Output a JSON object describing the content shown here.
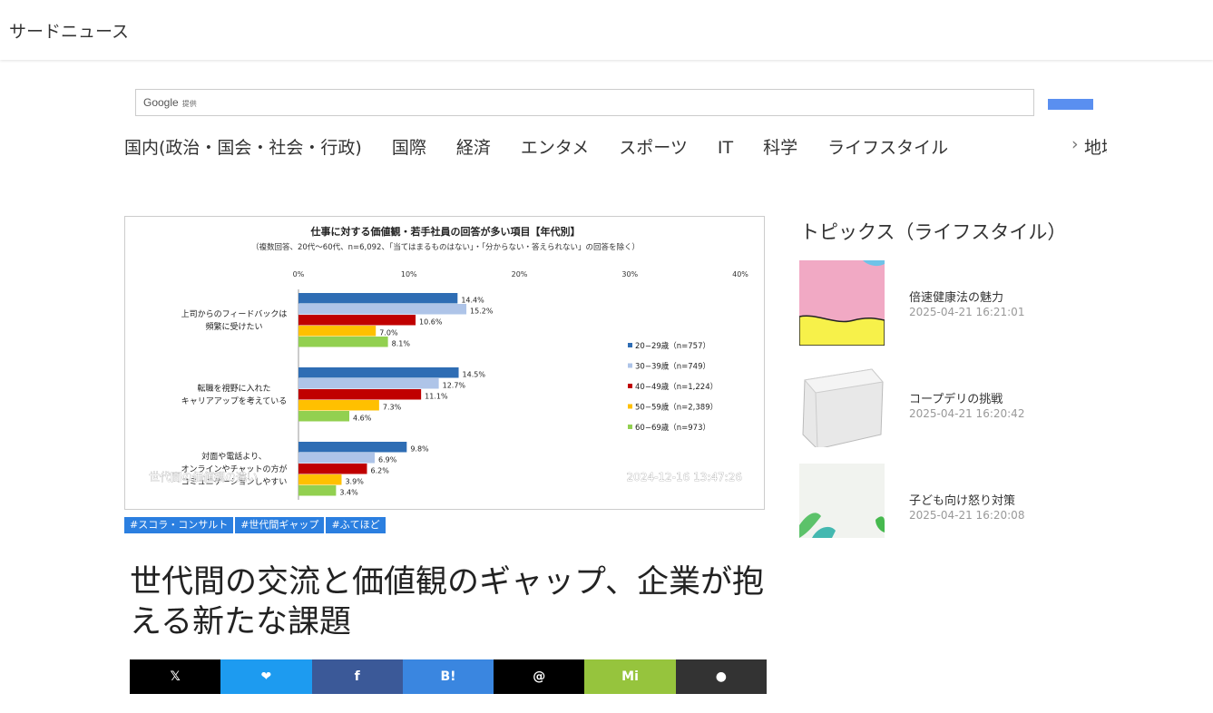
{
  "site": {
    "title": "サードニュース"
  },
  "search": {
    "brand": "Google",
    "brand_suffix": "提供",
    "placeholder": ""
  },
  "nav": {
    "items": [
      "国内(政治・国会・社会・行政)",
      "国際",
      "経済",
      "エンタメ",
      "スポーツ",
      "IT",
      "科学",
      "ライフスタイル"
    ],
    "overflow_item": "地域"
  },
  "article": {
    "image_overlay_caption": "世代間の価値観の違い",
    "image_timestamp": "2024-12-16 13:47:26",
    "tags": [
      "#スコラ・コンサルト",
      "#世代間ギャップ",
      "#ふてほど"
    ],
    "headline": "世代間の交流と価値観のギャップ、企業が抱える新たな課題"
  },
  "share": {
    "x_label": "𝕏",
    "bluesky_label": "❤",
    "facebook_label": "f",
    "hatena_label": "B!",
    "threads_label": "@",
    "misskey_label": "Mi",
    "mastodon_label": "●"
  },
  "topics": {
    "title": "トピックス（ライフスタイル）",
    "items": [
      {
        "title": "倍速健康法の魅力",
        "date": "2025-04-21 16:21:01"
      },
      {
        "title": "コープデリの挑戦",
        "date": "2025-04-21 16:20:42"
      },
      {
        "title": "子ども向け怒り対策",
        "date": "2025-04-21 16:20:08"
      }
    ]
  },
  "chart_data": {
    "type": "bar",
    "orientation": "horizontal",
    "title": "仕事に対する価値観・若手社員の回答が多い項目【年代別】",
    "subtitle": "（複数回答、20代〜60代、n=6,092、「当てはまるものはない」・「分からない・答えられない」の回答を除く）",
    "xlim": [
      0,
      40
    ],
    "x_ticks": [
      "0%",
      "10%",
      "20%",
      "30%",
      "40%"
    ],
    "categories": [
      "上司からのフィードバックは頻繁に受けたい",
      "転職を視野に入れたキャリアアップを考えている",
      "対面や電話より、オンラインやチャットの方がコミュニケーションしやすい"
    ],
    "category_lines": [
      [
        "上司からのフィードバックは",
        "頻繁に受けたい"
      ],
      [
        "転職を視野に入れた",
        "キャリアアップを考えている"
      ],
      [
        "対面や電話より、",
        "オンラインやチャットの方が",
        "コミュニケーションしやすい"
      ]
    ],
    "series": [
      {
        "name": "20−29歳（n=757）",
        "color": "#2e6db4",
        "values": [
          14.4,
          14.5,
          9.8
        ],
        "labels": [
          "14.4%",
          "14.5%",
          "9.8%"
        ]
      },
      {
        "name": "30−39歳（n=749）",
        "color": "#aec4e8",
        "values": [
          15.2,
          12.7,
          6.9
        ],
        "labels": [
          "15.2%",
          "12.7%",
          "6.9%"
        ]
      },
      {
        "name": "40−49歳（n=1,224）",
        "color": "#c00000",
        "values": [
          10.6,
          11.1,
          6.2
        ],
        "labels": [
          "10.6%",
          "11.1%",
          "6.2%"
        ]
      },
      {
        "name": "50−59歳（n=2,389）",
        "color": "#ffc000",
        "values": [
          7.0,
          7.3,
          3.9
        ],
        "labels": [
          "7.0%",
          "7.3%",
          "3.9%"
        ]
      },
      {
        "name": "60−69歳（n=973）",
        "color": "#92d050",
        "values": [
          8.1,
          4.6,
          3.4
        ],
        "labels": [
          "8.1%",
          "4.6%",
          "3.4%"
        ]
      }
    ],
    "legend": "right"
  }
}
